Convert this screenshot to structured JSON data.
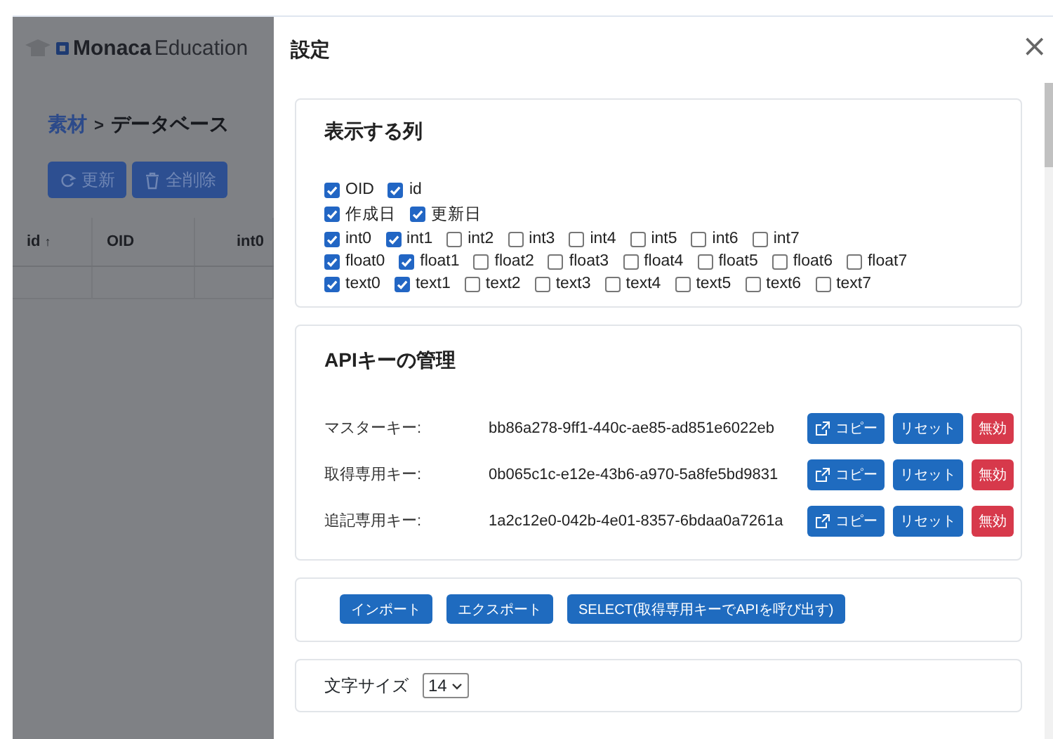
{
  "app": {
    "logo": {
      "name": "Monaca",
      "product": "Education"
    },
    "breadcrumb": {
      "parent": "素材",
      "separator": ">",
      "current": "データベース"
    },
    "buttons": [
      {
        "label": "更新"
      },
      {
        "label": "全削除"
      }
    ],
    "table": {
      "columns": [
        {
          "label": "id",
          "sort_mark": "↑"
        },
        {
          "label": "OID"
        },
        {
          "label": "int0"
        }
      ]
    }
  },
  "modal": {
    "title": "設定",
    "close": "×",
    "columns": {
      "title": "表示する列",
      "groups": [
        {
          "options": [
            {
              "label": "OID",
              "checked": true
            },
            {
              "label": "id",
              "checked": true
            }
          ]
        },
        {
          "options": [
            {
              "label": "作成日",
              "checked": true
            },
            {
              "label": "更新日",
              "checked": true
            }
          ]
        },
        {
          "options": [
            {
              "label": "int0",
              "checked": true
            },
            {
              "label": "int1",
              "checked": true
            },
            {
              "label": "int2",
              "checked": false
            },
            {
              "label": "int3",
              "checked": false
            },
            {
              "label": "int4",
              "checked": false
            },
            {
              "label": "int5",
              "checked": false
            },
            {
              "label": "int6",
              "checked": false
            },
            {
              "label": "int7",
              "checked": false
            }
          ]
        },
        {
          "options": [
            {
              "label": "float0",
              "checked": true
            },
            {
              "label": "float1",
              "checked": true
            },
            {
              "label": "float2",
              "checked": false
            },
            {
              "label": "float3",
              "checked": false
            },
            {
              "label": "float4",
              "checked": false
            },
            {
              "label": "float5",
              "checked": false
            },
            {
              "label": "float6",
              "checked": false
            },
            {
              "label": "float7",
              "checked": false
            }
          ]
        },
        {
          "options": [
            {
              "label": "text0",
              "checked": true
            },
            {
              "label": "text1",
              "checked": true
            },
            {
              "label": "text2",
              "checked": false
            },
            {
              "label": "text3",
              "checked": false
            },
            {
              "label": "text4",
              "checked": false
            },
            {
              "label": "text5",
              "checked": false
            },
            {
              "label": "text6",
              "checked": false
            },
            {
              "label": "text7",
              "checked": false
            }
          ]
        }
      ]
    },
    "api_keys": {
      "title": "APIキーの管理",
      "keys": [
        {
          "label": "マスターキー:",
          "value": "bb86a278-9ff1-440c-ae85-ad851e6022eb",
          "actions": [
            {
              "label": "コピー",
              "kind": "copy"
            },
            {
              "label": "リセット",
              "kind": "primary"
            },
            {
              "label": "無効",
              "kind": "danger"
            }
          ]
        },
        {
          "label": "取得専用キー:",
          "value": "0b065c1c-e12e-43b6-a970-5a8fe5bd9831",
          "actions": [
            {
              "label": "コピー",
              "kind": "copy"
            },
            {
              "label": "リセット",
              "kind": "primary"
            },
            {
              "label": "無効",
              "kind": "danger"
            }
          ]
        },
        {
          "label": "追記専用キー:",
          "value": "1a2c12e0-042b-4e01-8357-6bdaa0a7261a",
          "actions": [
            {
              "label": "コピー",
              "kind": "copy"
            },
            {
              "label": "リセット",
              "kind": "primary"
            },
            {
              "label": "無効",
              "kind": "danger"
            }
          ]
        }
      ]
    },
    "data_buttons": [
      {
        "label": "インポート"
      },
      {
        "label": "エクスポート"
      },
      {
        "label": "SELECT(取得専用キーでAPIを呼び出す)"
      }
    ],
    "font_size": {
      "label": "文字サイズ",
      "value": "14"
    }
  }
}
